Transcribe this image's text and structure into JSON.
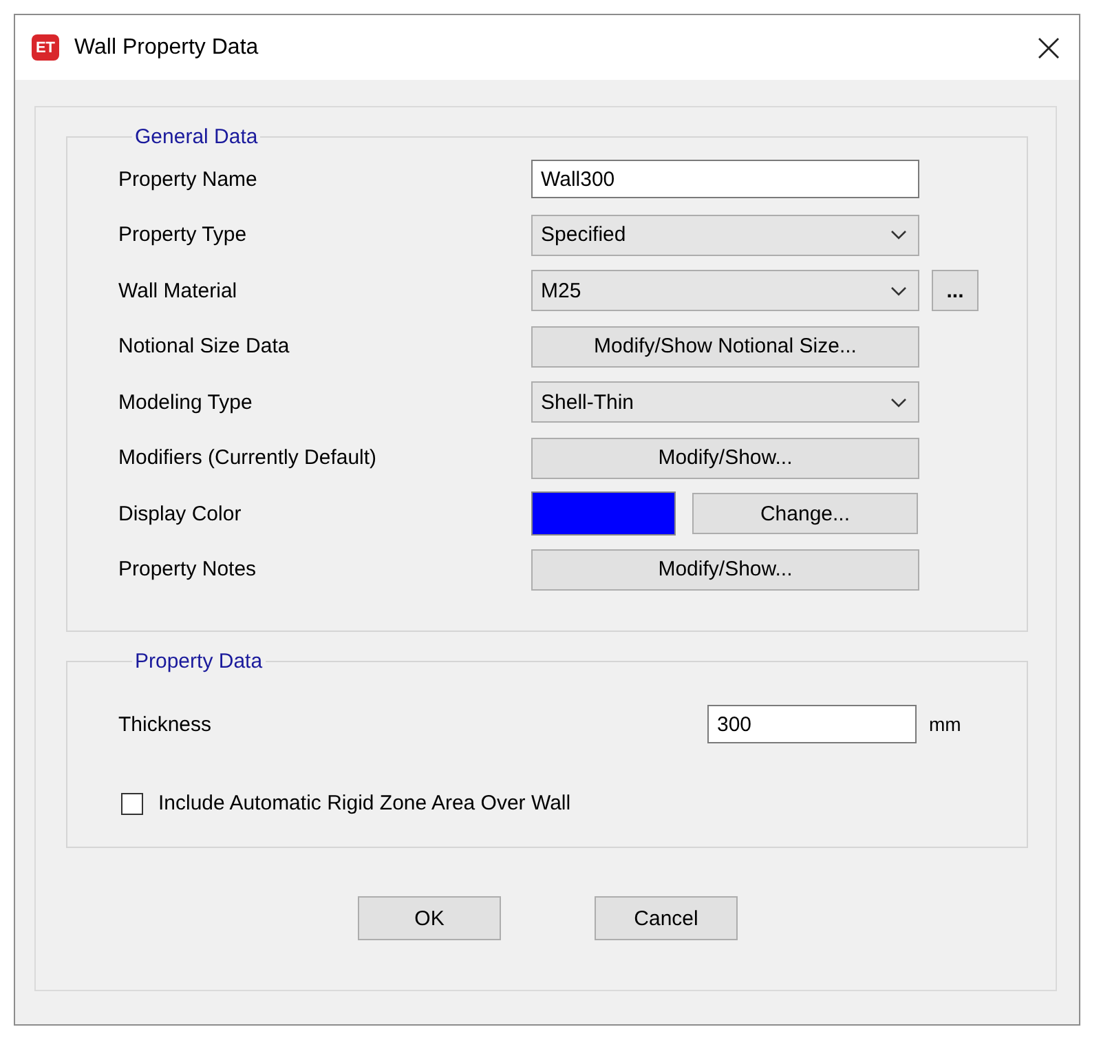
{
  "window": {
    "title": "Wall Property Data",
    "app_icon": "ET"
  },
  "general_data": {
    "title": "General Data",
    "rows": [
      {
        "kind": "text",
        "label": "Property Name",
        "value": "Wall300"
      },
      {
        "kind": "dropdown",
        "label": "Property Type",
        "value": "Specified"
      },
      {
        "kind": "dropdown",
        "label": "Wall Material",
        "value": "M25",
        "extra_button": "..."
      },
      {
        "kind": "button",
        "label": "Notional Size Data",
        "button": "Modify/Show Notional Size..."
      },
      {
        "kind": "dropdown",
        "label": "Modeling Type",
        "value": "Shell-Thin"
      },
      {
        "kind": "button",
        "label": "Modifiers (Currently Default)",
        "button": "Modify/Show..."
      },
      {
        "kind": "color",
        "label": "Display Color",
        "color": "#0000ff",
        "button": "Change..."
      },
      {
        "kind": "button",
        "label": "Property Notes",
        "button": "Modify/Show..."
      }
    ]
  },
  "property_data": {
    "title": "Property Data",
    "thickness": {
      "label": "Thickness",
      "value": "300",
      "unit": "mm"
    },
    "rigid_zone": {
      "label": "Include Automatic Rigid Zone Area Over Wall",
      "checked": false
    }
  },
  "buttons": [
    "OK",
    "Cancel"
  ]
}
